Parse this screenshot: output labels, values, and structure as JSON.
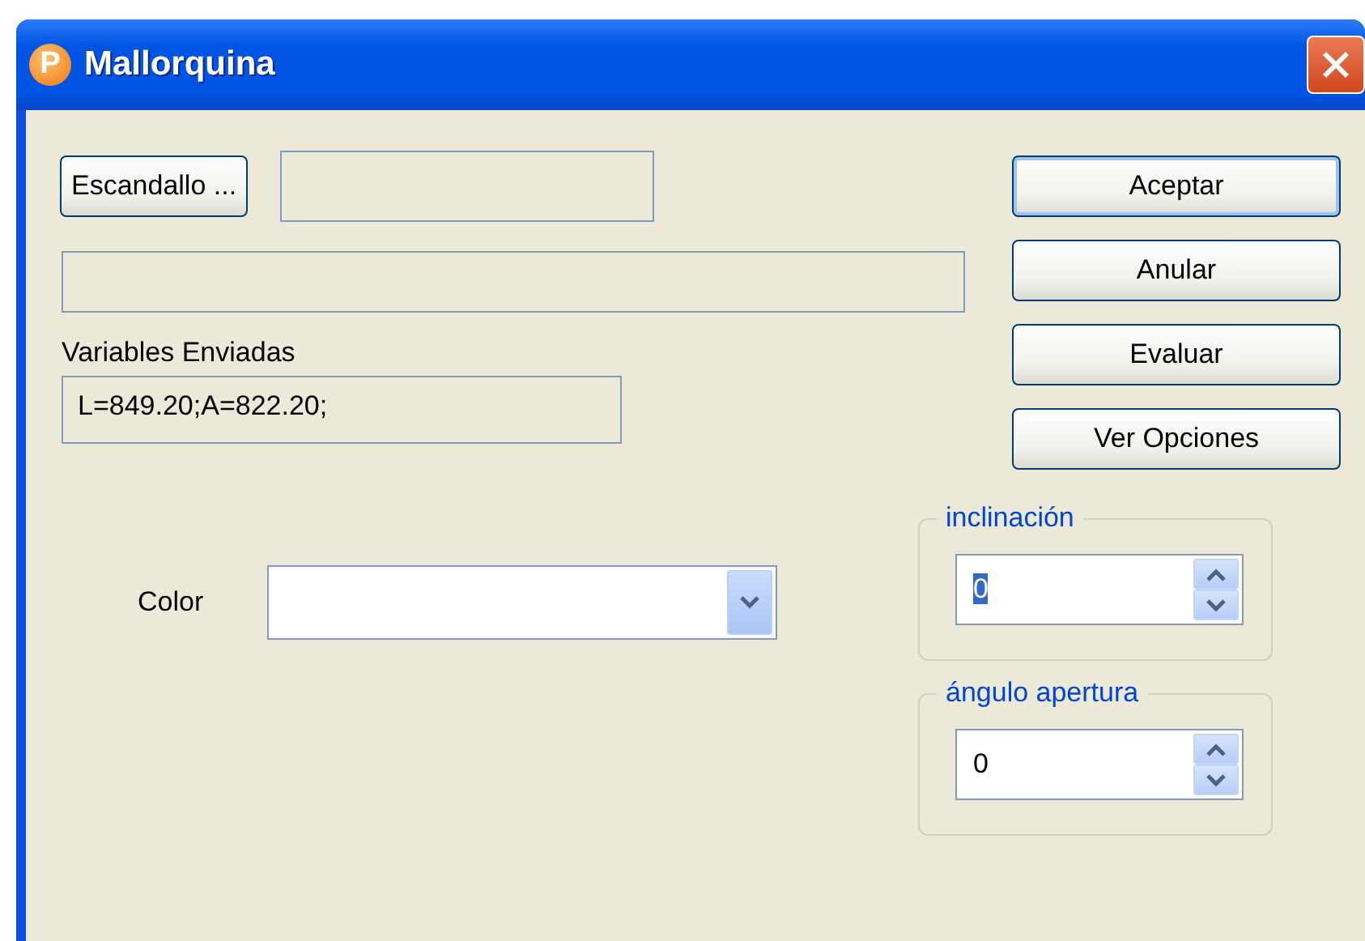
{
  "window": {
    "title": "Mallorquina",
    "icon_letter": "P"
  },
  "escandallo": {
    "label": "Escandallo ..."
  },
  "variables": {
    "label": "Variables Enviadas",
    "value": "L=849.20;A=822.20;"
  },
  "buttons": [
    {
      "label": "Aceptar",
      "default": true
    },
    {
      "label": "Anular",
      "default": false
    },
    {
      "label": "Evaluar",
      "default": false
    },
    {
      "label": "Ver Opciones",
      "default": false
    }
  ],
  "color": {
    "label": "Color"
  },
  "groups": [
    {
      "title": "inclinación",
      "value": "0",
      "selected": true
    },
    {
      "title": "ángulo apertura",
      "value": "0",
      "selected": false
    }
  ]
}
